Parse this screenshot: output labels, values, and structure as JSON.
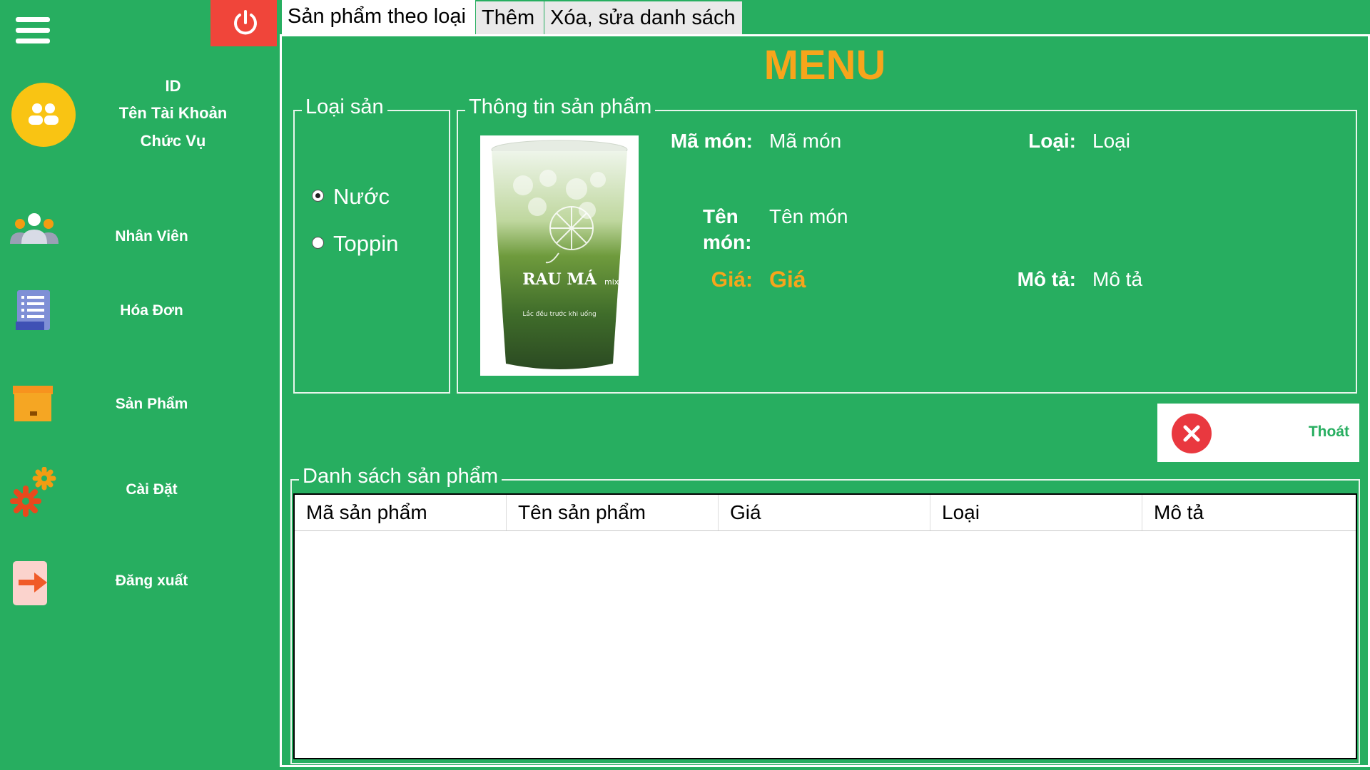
{
  "sidebar": {
    "account": {
      "id": "ID",
      "name": "Tên Tài Khoản",
      "role": "Chức Vụ"
    },
    "items": [
      {
        "label": "Nhân Viên",
        "icon": "staff-icon"
      },
      {
        "label": "Hóa Đơn",
        "icon": "invoice-icon"
      },
      {
        "label": "Sản Phẩm",
        "icon": "box-icon"
      },
      {
        "label": "Cài Đặt",
        "icon": "gear-icon"
      },
      {
        "label": "Đăng xuất",
        "icon": "logout-icon"
      }
    ]
  },
  "tabs": [
    {
      "label": "Sản phẩm theo loại",
      "active": true
    },
    {
      "label": "Thêm"
    },
    {
      "label": "Xóa, sửa danh sách"
    }
  ],
  "main": {
    "title": "MENU",
    "category_group": {
      "title": "Loại sản",
      "options": [
        {
          "label": "Nước",
          "checked": true
        },
        {
          "label": "Toppin",
          "checked": false
        }
      ]
    },
    "info_group": {
      "title": "Thông tin sản phẩm",
      "image_text": {
        "brand": "RAU MÁ",
        "suffix": "mix",
        "note": "Lắc đều trước khi uống"
      },
      "fields": {
        "code_label": "Mã món:",
        "code_value": "Mã món",
        "type_label": "Loại:",
        "type_value": "Loại",
        "name_label_1": "Tên",
        "name_label_2": "món:",
        "name_value": "Tên món",
        "price_label": "Giá:",
        "price_value": "Giá",
        "desc_label": "Mô tả:",
        "desc_value": "Mô tả"
      }
    },
    "exit_button": {
      "label": "Thoát"
    },
    "list_group": {
      "title": "Danh sách sản phẩm",
      "columns": [
        "Mã sản phẩm",
        "Tên sản phẩm",
        "Giá",
        "Loại",
        "Mô tả"
      ],
      "rows": []
    }
  },
  "colors": {
    "background": "#27ae60",
    "accent": "#f7a51b",
    "power": "#f0453a",
    "exit": "#e9383f"
  }
}
